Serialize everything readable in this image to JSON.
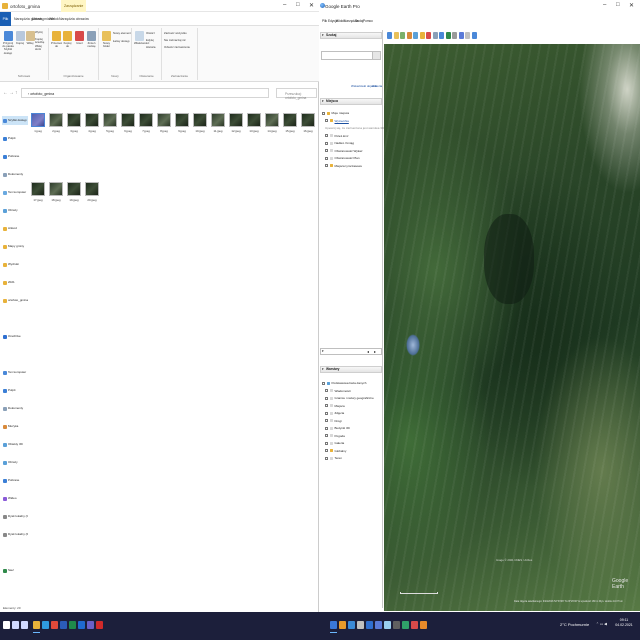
{
  "explorer": {
    "title": "ortofoto_gmina",
    "window_controls": [
      "–",
      "□",
      "✕"
    ],
    "tabs": {
      "file": "Plik",
      "home": "Narzędzia główne",
      "share": "Udostępnianie",
      "view": "Widok",
      "manage": "Zarządzanie",
      "manage2": "Narzędzia obrazów"
    },
    "ribbon": {
      "buttons": [
        "Przypnij do paska Szybki dostęp",
        "Kopiuj",
        "Wklej",
        "Wytnij",
        "Kopiuj ścieżkę",
        "Wklej skrót",
        "Przenieś do",
        "Kopiuj do",
        "Usuń",
        "Zmień nazwę",
        "Nowy folder",
        "Nowy element",
        "Łatwy dostęp",
        "Właściwości",
        "Otwórz",
        "Edytuj",
        "Historia",
        "Zaznacz wszystko",
        "Nie zaznaczaj nic",
        "Odwróć zaznaczenie"
      ],
      "groups": [
        "Schowek",
        "Organizowanie",
        "Nowy",
        "Otwieranie",
        "Zaznaczanie"
      ]
    },
    "address": {
      "path": "› ortofoto_gmina",
      "search_placeholder": "Przeszukaj: ortofoto_gmina",
      "nav": [
        "←",
        "→",
        "↑"
      ]
    },
    "nav_items": [
      {
        "label": "Szybki dostęp",
        "color": "#4a88d8",
        "selected": true
      },
      {
        "label": "Pulpit",
        "color": "#3b7fd6"
      },
      {
        "label": "Pobrane",
        "color": "#3b7fd6"
      },
      {
        "label": "Dokumenty",
        "color": "#8aa0b8"
      },
      {
        "label": "Ten komputer",
        "color": "#6aa9e0"
      },
      {
        "label": "Obrazy",
        "color": "#5aa0d8"
      },
      {
        "label": "Arkusz",
        "color": "#e8b23a"
      },
      {
        "label": "Mapy gminy",
        "color": "#e8b23a"
      },
      {
        "label": "Wydruki",
        "color": "#e8b23a"
      },
      {
        "label": "2021",
        "color": "#e8b23a"
      },
      {
        "label": "ortofoto_gmina",
        "color": "#e8b23a"
      },
      {
        "label": "",
        "color": "#ffffff"
      },
      {
        "label": "OneDrive",
        "color": "#2f6fd0"
      },
      {
        "label": "",
        "color": "#ffffff"
      },
      {
        "label": "Ten komputer",
        "color": "#4a88d8"
      },
      {
        "label": "Pulpit",
        "color": "#3b7fd6"
      },
      {
        "label": "Dokumenty",
        "color": "#8aa0b8"
      },
      {
        "label": "Muzyka",
        "color": "#d88a3b"
      },
      {
        "label": "Obiekty 3D",
        "color": "#5aa0d8"
      },
      {
        "label": "Obrazy",
        "color": "#5aa0d8"
      },
      {
        "label": "Pobrane",
        "color": "#3b7fd6"
      },
      {
        "label": "Wideo",
        "color": "#8a5ad8"
      },
      {
        "label": "Dysk lokalny (C:)",
        "color": "#888888"
      },
      {
        "label": "Dysk lokalny (D:)",
        "color": "#888888"
      },
      {
        "label": "",
        "color": "#ffffff"
      },
      {
        "label": "Sieć",
        "color": "#2f8a4a"
      }
    ],
    "files_row1": [
      "1.jpeg",
      "2.jpeg",
      "3.jpeg",
      "4.jpeg",
      "5.jpeg",
      "6.jpeg",
      "7.jpeg",
      "8.jpeg",
      "9.jpeg",
      "10.jpeg",
      "11.jpeg",
      "12.jpeg",
      "13.jpeg",
      "14.jpeg",
      "15.jpeg",
      "16.jpeg"
    ],
    "files_row2": [
      "17.jpeg",
      "18.jpeg",
      "19.jpeg",
      "20.jpeg"
    ],
    "status": "Elementy: 20"
  },
  "google_earth": {
    "title": "Google Earth Pro",
    "menu": [
      "Plik",
      "Edycja",
      "Widok",
      "Narzędzia",
      "Dodaj",
      "Pomoc"
    ],
    "search_header": "Szukaj",
    "search_links": [
      "Wskazówki dojazdu",
      "Historia"
    ],
    "places_header": "Miejsca",
    "places": [
      {
        "label": "Moje miejsca",
        "link": false,
        "gray": false,
        "color": "#e8b23a"
      },
      {
        "label": "Wycieczka",
        "link": true,
        "gray": false,
        "color": "#e8b23a"
      },
      {
        "label": "Upewnij się, że zaznaczona jest warstwa 3D budynki",
        "link": false,
        "gray": true,
        "color": "#ffffff"
      },
      {
        "label": "Pole1.kmz",
        "link": false,
        "gray": false,
        "color": "#d8d8d8"
      },
      {
        "label": "Nadleś. Kmiąg",
        "link": false,
        "gray": false,
        "color": "#d8d8d8"
      },
      {
        "label": "Obszarowość Wykaz",
        "link": false,
        "gray": false,
        "color": "#d8d8d8"
      },
      {
        "label": "Obszarowość Plan",
        "link": false,
        "gray": false,
        "color": "#d8d8d8"
      },
      {
        "label": "Miejsca tymczasowe",
        "link": false,
        "gray": false,
        "color": "#e8b23a"
      }
    ],
    "layers_header": "Warstwy",
    "layers": [
      {
        "label": "Podstawowa baza danych",
        "color": "#5aa0d8"
      },
      {
        "label": "Wiadomości",
        "color": "#d8d8d8"
      },
      {
        "label": "Granice i nazwy geograficzne",
        "color": "#d8d8d8"
      },
      {
        "label": "Miejsca",
        "color": "#d8d8d8"
      },
      {
        "label": "Zdjęcia",
        "color": "#d8d8d8"
      },
      {
        "label": "Drogi",
        "color": "#d8d8d8"
      },
      {
        "label": "Budynki 3D",
        "color": "#d8d8d8"
      },
      {
        "label": "Pogoda",
        "color": "#d8d8d8"
      },
      {
        "label": "Galeria",
        "color": "#d8d8d8"
      },
      {
        "label": "Globalny",
        "color": "#e8b23a"
      },
      {
        "label": "Teren",
        "color": "#d8d8d8"
      }
    ],
    "nav_arrows": [
      "◂",
      "▸"
    ],
    "brand": "Google Earth",
    "coords": "Image © 2021 CNES / Airbus",
    "status": "Data zdjęcia satelitarnego: 9/24/2016  52°33'06\" N  23°26'46\" E  wysokość 180 m  Wys. widoku 10.37 km"
  },
  "taskbar": {
    "weather": "2°C Pochmurnie",
    "time": "09:11",
    "date": "04.02.2021",
    "apps": [
      {
        "name": "start",
        "color": "#ffffff"
      },
      {
        "name": "search",
        "color": "#cfd8ff"
      },
      {
        "name": "task-view",
        "color": "#cfd8ff"
      },
      {
        "name": "file-explorer",
        "color": "#e8b23a"
      },
      {
        "name": "edge",
        "color": "#2f9ae0"
      },
      {
        "name": "chrome",
        "color": "#e04a3a"
      },
      {
        "name": "word",
        "color": "#2b5cb8"
      },
      {
        "name": "excel",
        "color": "#1f8a4a"
      },
      {
        "name": "outlook",
        "color": "#1f6ad0"
      },
      {
        "name": "teams",
        "color": "#6a60c8"
      },
      {
        "name": "acrobat",
        "color": "#d02a2a"
      },
      {
        "name": "google-earth",
        "color": "#3a78d8"
      },
      {
        "name": "paint",
        "color": "#e89a2a"
      },
      {
        "name": "photos",
        "color": "#3a8ad8"
      },
      {
        "name": "settings",
        "color": "#c0c0c0"
      },
      {
        "name": "mail",
        "color": "#2f6fd0"
      },
      {
        "name": "store",
        "color": "#5a7ad8"
      },
      {
        "name": "notepad",
        "color": "#9ad0f0"
      },
      {
        "name": "calculator",
        "color": "#606060"
      },
      {
        "name": "maps",
        "color": "#2fa06a"
      },
      {
        "name": "pdf",
        "color": "#d84a4a"
      },
      {
        "name": "vlc",
        "color": "#e88a2a"
      }
    ]
  },
  "colors": {
    "taskbar_bg": "#1c1f3b",
    "accent": "#1a5fb4",
    "explorer_ctx_tab": "#fff6c4"
  }
}
